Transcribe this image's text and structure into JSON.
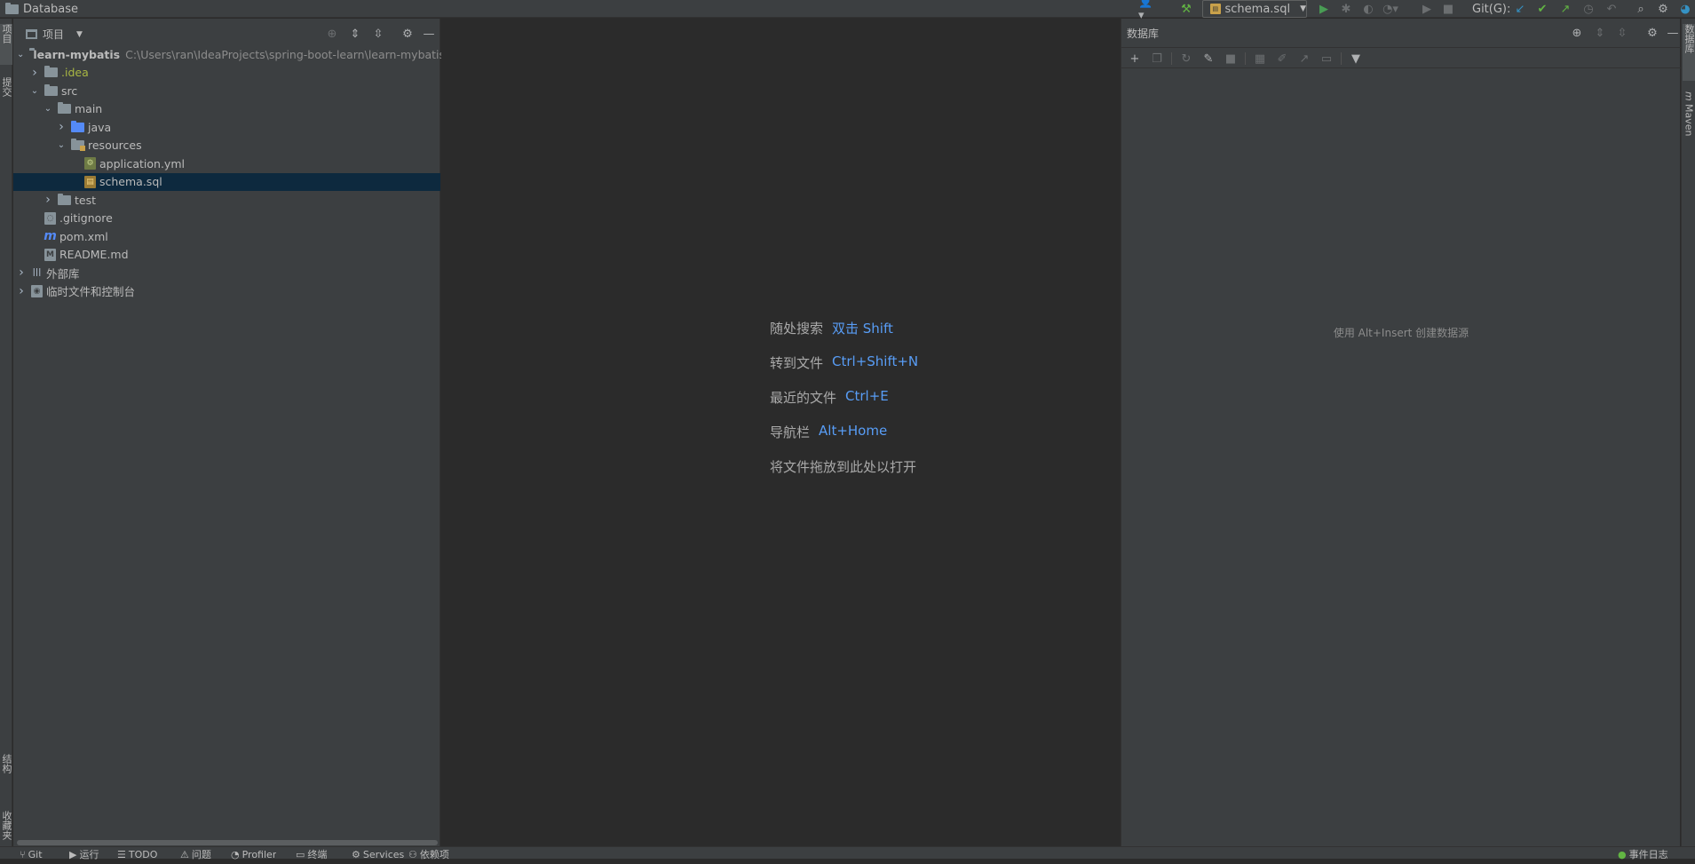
{
  "nav": {
    "title": "Database"
  },
  "toolbar": {
    "run_config": "schema.sql",
    "git_label": "Git(G):",
    "icons": [
      "user-icon",
      "build-hammer-icon",
      "run-icon",
      "debug-icon",
      "coverage-icon",
      "profile-icon",
      "run-more-icon",
      "stop-icon",
      "git-update-icon",
      "git-commit-icon",
      "git-push-icon",
      "git-history-icon",
      "git-rollback-icon",
      "search-icon",
      "settings-icon"
    ]
  },
  "left_stripe": {
    "project": "项目",
    "commit": "提交",
    "structure": "结构",
    "favorites": "收藏夹"
  },
  "project": {
    "view_label": "项目",
    "tree": [
      {
        "label": "learn-mybatis",
        "path": "C:\\Users\\ran\\IdeaProjects\\spring-boot-learn\\learn-mybatis",
        "indent": 0,
        "chev": "open",
        "icon": "module"
      },
      {
        "label": ".idea",
        "indent": 1,
        "chev": "closed",
        "icon": "folder",
        "style": "idea"
      },
      {
        "label": "src",
        "indent": 1,
        "chev": "open",
        "icon": "folder"
      },
      {
        "label": "main",
        "indent": 2,
        "chev": "open",
        "icon": "folder"
      },
      {
        "label": "java",
        "indent": 3,
        "chev": "closed",
        "icon": "folder-blue"
      },
      {
        "label": "resources",
        "indent": 3,
        "chev": "open",
        "icon": "folder-res"
      },
      {
        "label": "application.yml",
        "indent": 4,
        "chev": "none",
        "icon": "yml"
      },
      {
        "label": "schema.sql",
        "indent": 4,
        "chev": "none",
        "icon": "sql",
        "selected": true
      },
      {
        "label": "test",
        "indent": 2,
        "chev": "closed",
        "icon": "folder"
      },
      {
        "label": ".gitignore",
        "indent": 1,
        "chev": "none",
        "icon": "git"
      },
      {
        "label": "pom.xml",
        "indent": 1,
        "chev": "none",
        "icon": "pom"
      },
      {
        "label": "README.md",
        "indent": 1,
        "chev": "none",
        "icon": "md"
      },
      {
        "label": "外部库",
        "indent": 0,
        "chev": "closed",
        "icon": "lib"
      },
      {
        "label": "临时文件和控制台",
        "indent": 0,
        "chev": "closed",
        "icon": "scratch"
      }
    ]
  },
  "editor": {
    "hints": [
      {
        "label": "随处搜索",
        "key": "双击 Shift"
      },
      {
        "label": "转到文件",
        "key": "Ctrl+Shift+N"
      },
      {
        "label": "最近的文件",
        "key": "Ctrl+E"
      },
      {
        "label": "导航栏",
        "key": "Alt+Home"
      },
      {
        "label": "将文件拖放到此处以打开",
        "key": ""
      }
    ]
  },
  "database": {
    "title": "数据库",
    "empty_text": "使用 Alt+Insert 创建数据源"
  },
  "right_stripe": {
    "database": "数据库",
    "maven": "Maven"
  },
  "bottom": {
    "items": [
      "Git",
      "运行",
      "TODO",
      "问题",
      "Profiler",
      "终端",
      "Services",
      "依赖项"
    ],
    "event_log": "事件日志"
  }
}
